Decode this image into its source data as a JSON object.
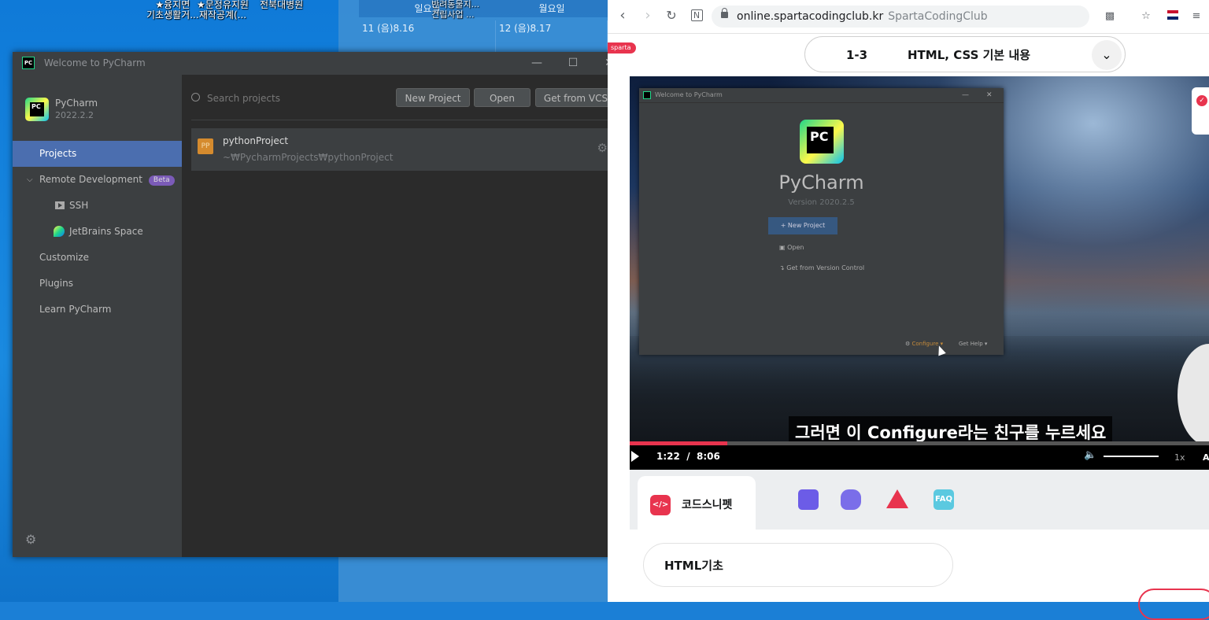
{
  "desktop": {
    "icons": [
      {
        "line1": "★융지면",
        "line2": "기초생활거..."
      },
      {
        "line1": "★문정유지원",
        "line2": "재작공계(..."
      },
      {
        "line1": "전북대병원",
        "line2": ""
      }
    ],
    "calendar": {
      "col1_head": "일요일",
      "col1_overlay1": "반려동물지...",
      "col1_overlay2": "건립사업 ...",
      "col2_head": "월요일",
      "col1_date": "11 (음)8.16",
      "col2_date": "12 (음)8.17"
    }
  },
  "pycharm": {
    "window_title": "Welcome to PyCharm",
    "logo_text": "PC",
    "brand_name": "PyCharm",
    "brand_version": "2022.2.2",
    "nav": [
      {
        "label": "Projects"
      },
      {
        "label": "Remote Development",
        "badge": "Beta"
      },
      {
        "label": "SSH"
      },
      {
        "label": "JetBrains Space"
      },
      {
        "label": "Customize"
      },
      {
        "label": "Plugins"
      },
      {
        "label": "Learn PyCharm"
      }
    ],
    "search_placeholder": "Search projects",
    "buttons": {
      "new_project": "New Project",
      "open": "Open",
      "get_from_vcs": "Get from VCS"
    },
    "project": {
      "icon_text": "PP",
      "name": "pythonProject",
      "path": "~₩PycharmProjects₩pythonProject"
    }
  },
  "browser": {
    "url": "online.spartacodingclub.kr",
    "site_name": "SpartaCodingClub",
    "badge": "sparta",
    "lesson": {
      "number": "1-3",
      "title": "HTML, CSS 기본 내용"
    },
    "video": {
      "inner_title": "Welcome to PyCharm",
      "inner_logo": "PC",
      "inner_name": "PyCharm",
      "inner_version": "Version 2020.2.5",
      "inner_new_project": "+ New Project",
      "inner_open": "Open",
      "inner_vcs": "Get from Version Control",
      "inner_configure": "Configure ▾",
      "inner_help": "Get Help ▾",
      "subtitle": "그러면 이 Configure라는 친구를 누르세요",
      "current_time": "1:22",
      "separator": "/",
      "duration": "8:06",
      "speed": "1x",
      "last_control": "A",
      "progress": 0.169
    },
    "tabs": {
      "snippet_icon": "</>",
      "snippet_label": "코드스니펫",
      "faq_label": "FAQ"
    },
    "chip": "HTML기초"
  }
}
